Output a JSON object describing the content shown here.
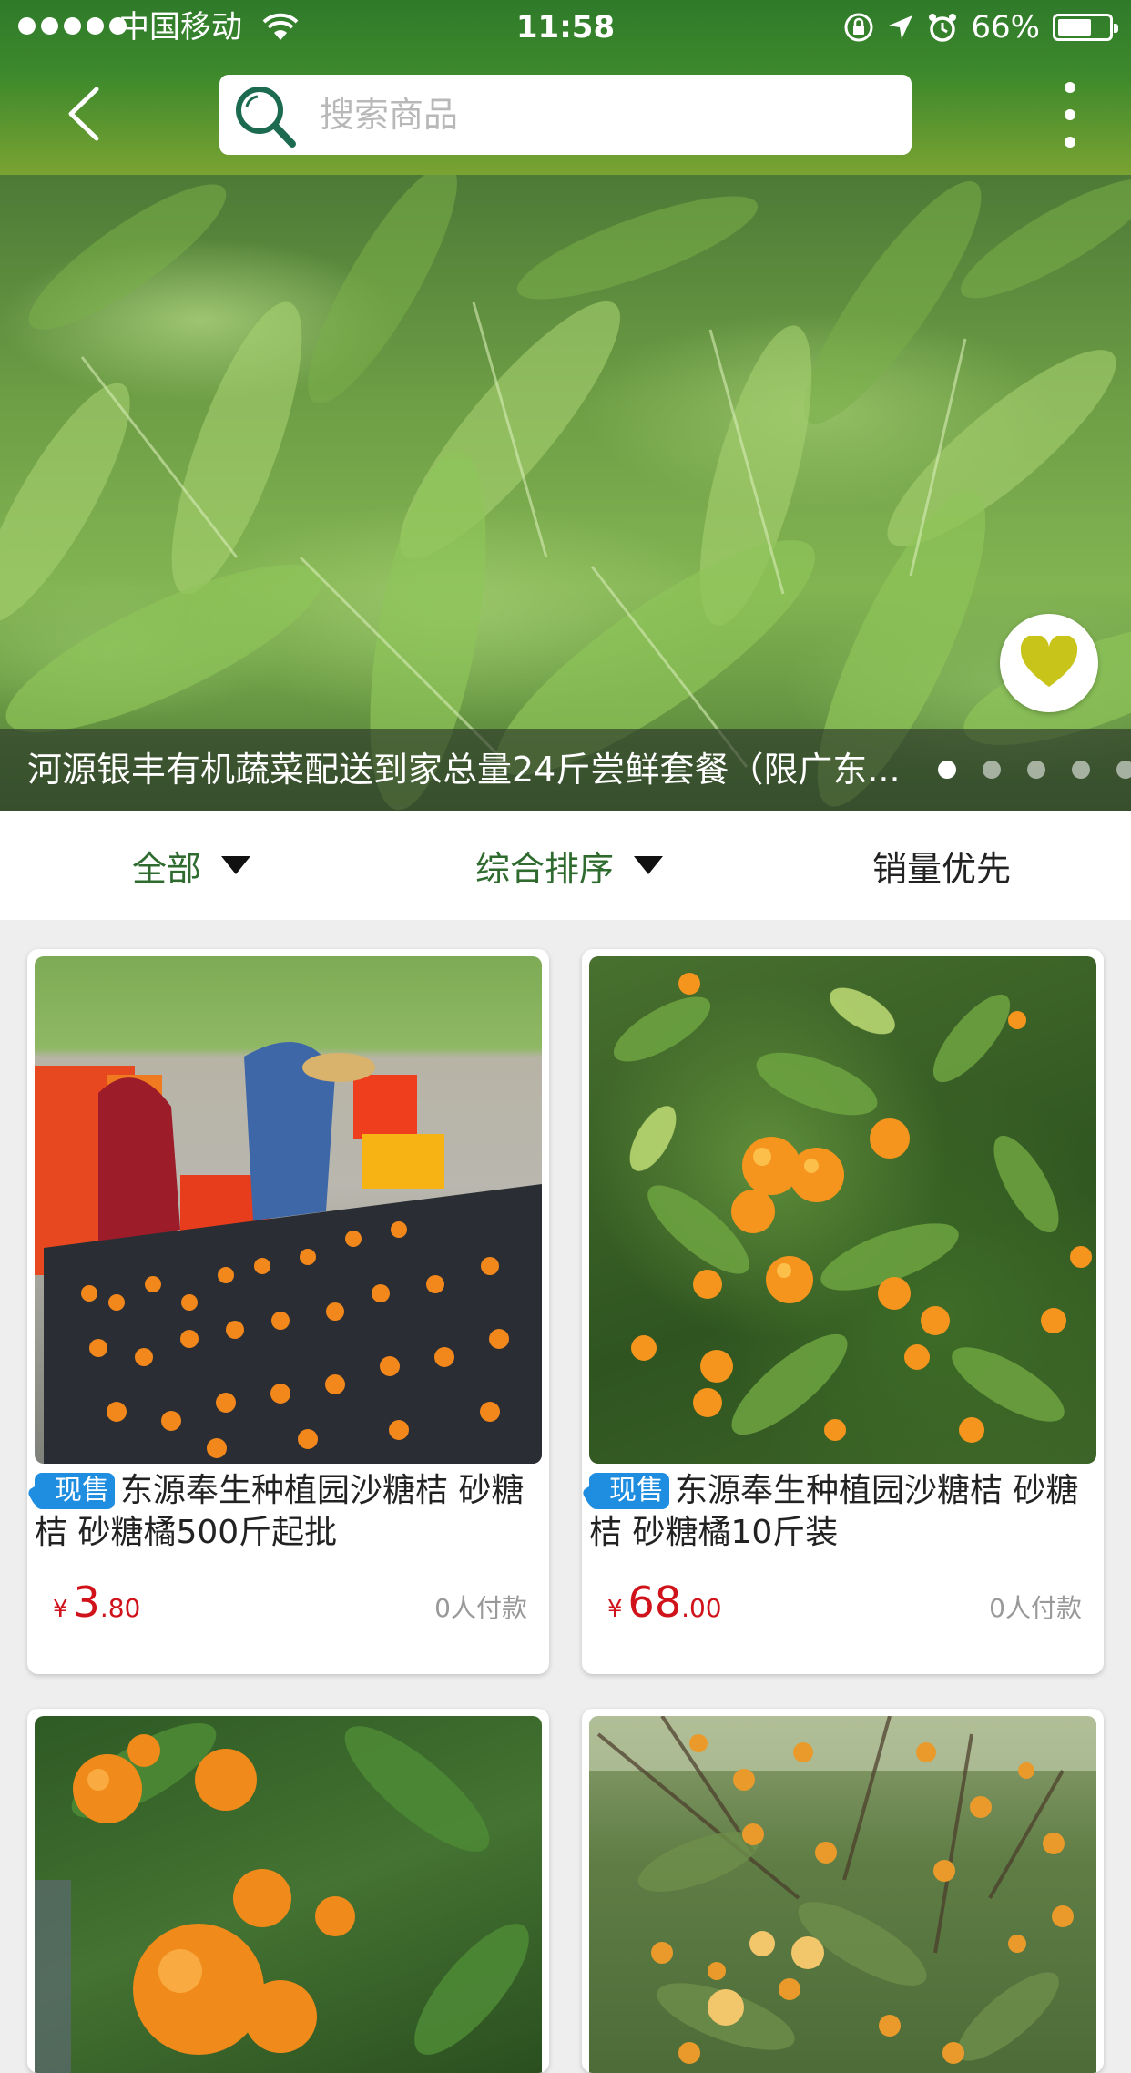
{
  "status_bar": {
    "carrier": "中国移动",
    "time": "11:58",
    "battery": "66%",
    "battery_level": 0.66
  },
  "nav": {
    "search_placeholder": "搜索商品"
  },
  "banner": {
    "title": "河源银丰有机蔬菜配送到家总量24斤尝鲜套餐（限广东...",
    "page_count": 5,
    "active_page": 1
  },
  "filters": {
    "all": "全部",
    "sort": "综合排序",
    "sales": "销量优先"
  },
  "products": [
    {
      "badge": "现售",
      "name": "东源奉生种植园沙糖桔 砂糖桔 砂糖橘500斤起批",
      "currency": "¥",
      "price_int": "3",
      "price_dec": ".80",
      "sold": "0人付款"
    },
    {
      "badge": "现售",
      "name": "东源奉生种植园沙糖桔 砂糖桔 砂糖橘10斤装",
      "currency": "¥",
      "price_int": "68",
      "price_dec": ".00",
      "sold": "0人付款"
    }
  ],
  "colors": {
    "header_green": "#3f8a2c",
    "filter_green": "#2f6b2f",
    "price_red": "#d0121b",
    "badge_blue": "#1f8de0",
    "heart_yellow": "#c8c41a"
  }
}
